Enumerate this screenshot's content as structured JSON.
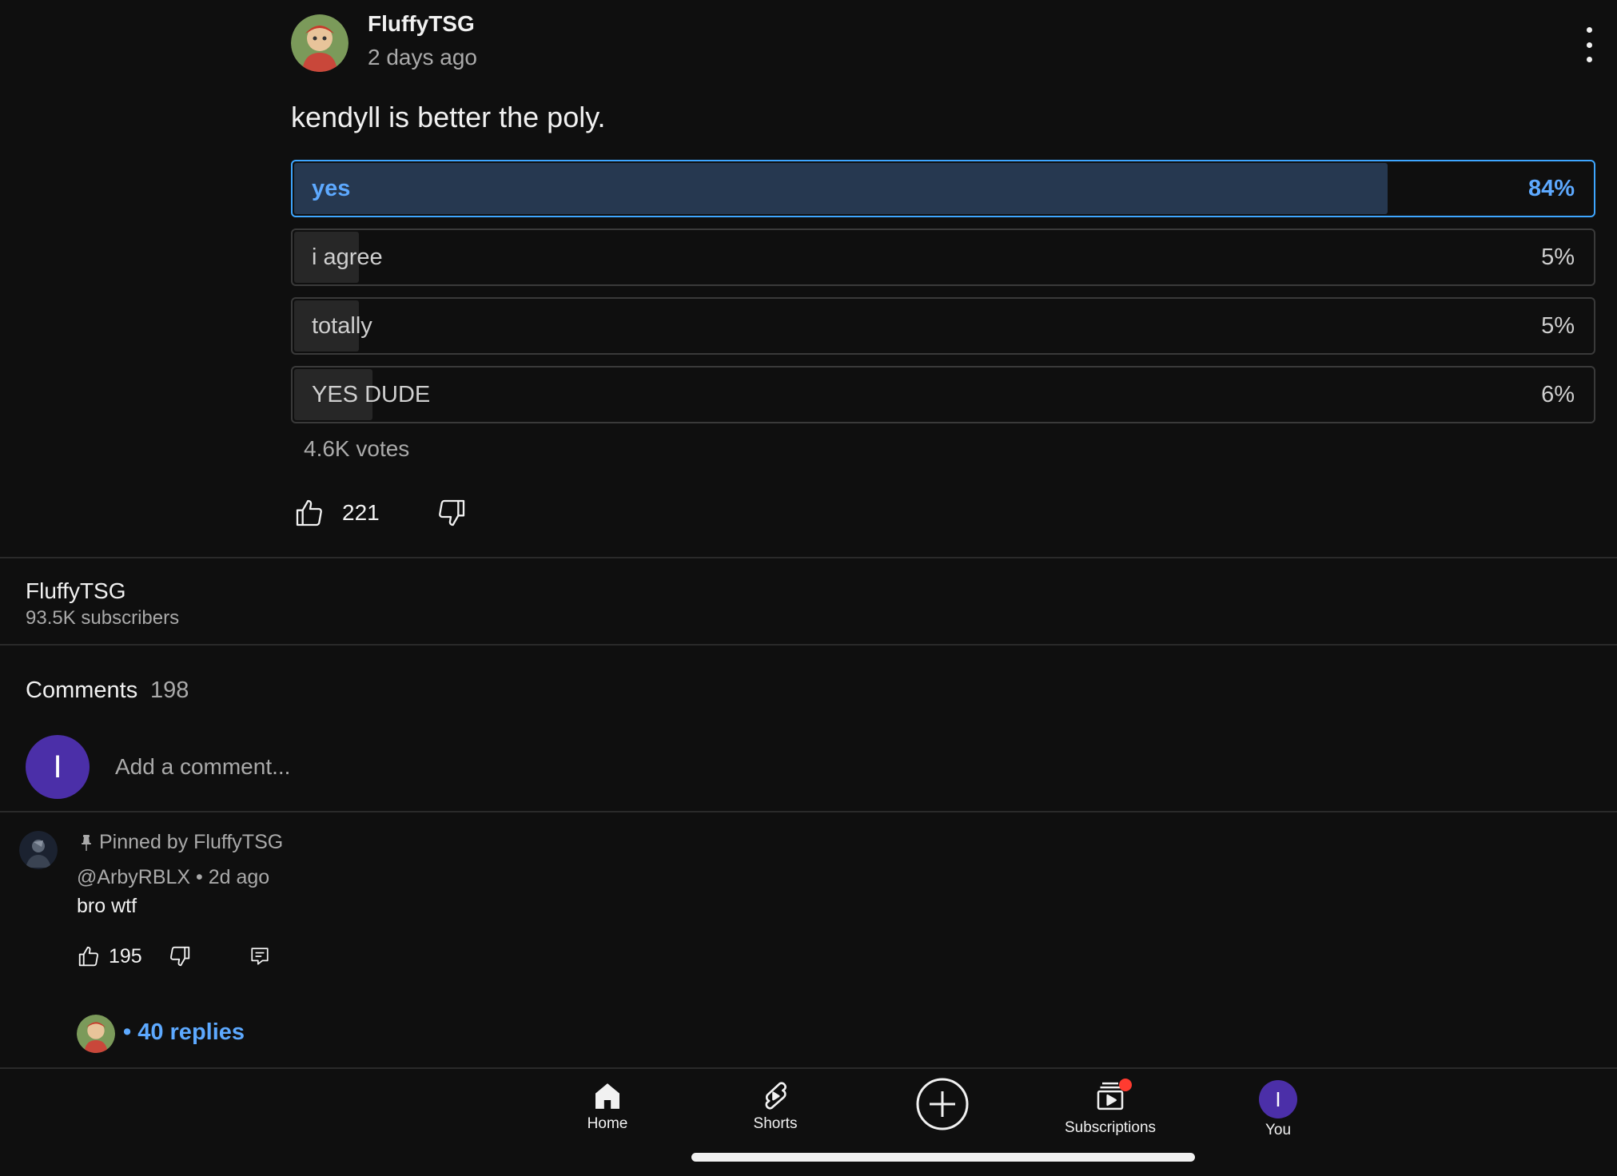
{
  "post": {
    "author": "FluffyTSG",
    "time": "2 days ago",
    "text": "kendyll is better the poly.",
    "poll": [
      {
        "label": "yes",
        "percent_text": "84%",
        "value": 84,
        "selected": true
      },
      {
        "label": "i agree",
        "percent_text": "5%",
        "value": 5,
        "selected": false
      },
      {
        "label": "totally",
        "percent_text": "5%",
        "value": 5,
        "selected": false
      },
      {
        "label": "YES DUDE",
        "percent_text": "6%",
        "value": 6,
        "selected": false
      }
    ],
    "votes": "4.6K votes",
    "likes": "221"
  },
  "channel": {
    "name": "FluffyTSG",
    "subscribers": "93.5K subscribers"
  },
  "comments": {
    "title": "Comments",
    "count": "198",
    "user_initial": "I",
    "placeholder": "Add a comment...",
    "items": [
      {
        "pinned_label": "Pinned by FluffyTSG",
        "meta": "@ArbyRBLX • 2d ago",
        "text": "bro wtf",
        "likes": "195",
        "replies": "• 40 replies"
      }
    ]
  },
  "nav": {
    "items": [
      {
        "label": "Home",
        "icon": "home-icon"
      },
      {
        "label": "Shorts",
        "icon": "shorts-icon"
      },
      {
        "label": "",
        "icon": "create-icon"
      },
      {
        "label": "Subscriptions",
        "icon": "subscriptions-icon"
      },
      {
        "label": "You",
        "icon": "avatar",
        "initial": "I"
      }
    ]
  },
  "colors": {
    "background": "#0f0f0f",
    "accent": "#3ea6ff",
    "avatar": "#4b2fa8",
    "notification": "#ff3b30"
  }
}
